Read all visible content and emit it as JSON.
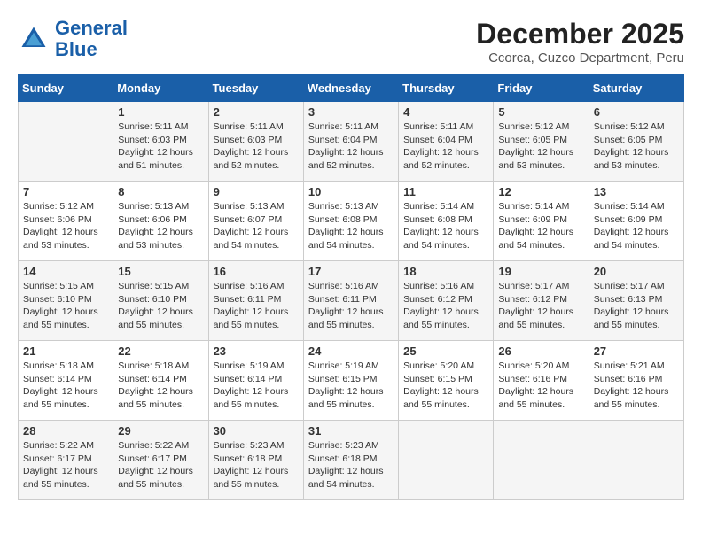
{
  "header": {
    "logo_line1": "General",
    "logo_line2": "Blue",
    "month": "December 2025",
    "location": "Ccorca, Cuzco Department, Peru"
  },
  "days_of_week": [
    "Sunday",
    "Monday",
    "Tuesday",
    "Wednesday",
    "Thursday",
    "Friday",
    "Saturday"
  ],
  "weeks": [
    [
      {
        "day": "",
        "content": ""
      },
      {
        "day": "1",
        "content": "Sunrise: 5:11 AM\nSunset: 6:03 PM\nDaylight: 12 hours\nand 51 minutes."
      },
      {
        "day": "2",
        "content": "Sunrise: 5:11 AM\nSunset: 6:03 PM\nDaylight: 12 hours\nand 52 minutes."
      },
      {
        "day": "3",
        "content": "Sunrise: 5:11 AM\nSunset: 6:04 PM\nDaylight: 12 hours\nand 52 minutes."
      },
      {
        "day": "4",
        "content": "Sunrise: 5:11 AM\nSunset: 6:04 PM\nDaylight: 12 hours\nand 52 minutes."
      },
      {
        "day": "5",
        "content": "Sunrise: 5:12 AM\nSunset: 6:05 PM\nDaylight: 12 hours\nand 53 minutes."
      },
      {
        "day": "6",
        "content": "Sunrise: 5:12 AM\nSunset: 6:05 PM\nDaylight: 12 hours\nand 53 minutes."
      }
    ],
    [
      {
        "day": "7",
        "content": "Sunrise: 5:12 AM\nSunset: 6:06 PM\nDaylight: 12 hours\nand 53 minutes."
      },
      {
        "day": "8",
        "content": "Sunrise: 5:13 AM\nSunset: 6:06 PM\nDaylight: 12 hours\nand 53 minutes."
      },
      {
        "day": "9",
        "content": "Sunrise: 5:13 AM\nSunset: 6:07 PM\nDaylight: 12 hours\nand 54 minutes."
      },
      {
        "day": "10",
        "content": "Sunrise: 5:13 AM\nSunset: 6:08 PM\nDaylight: 12 hours\nand 54 minutes."
      },
      {
        "day": "11",
        "content": "Sunrise: 5:14 AM\nSunset: 6:08 PM\nDaylight: 12 hours\nand 54 minutes."
      },
      {
        "day": "12",
        "content": "Sunrise: 5:14 AM\nSunset: 6:09 PM\nDaylight: 12 hours\nand 54 minutes."
      },
      {
        "day": "13",
        "content": "Sunrise: 5:14 AM\nSunset: 6:09 PM\nDaylight: 12 hours\nand 54 minutes."
      }
    ],
    [
      {
        "day": "14",
        "content": "Sunrise: 5:15 AM\nSunset: 6:10 PM\nDaylight: 12 hours\nand 55 minutes."
      },
      {
        "day": "15",
        "content": "Sunrise: 5:15 AM\nSunset: 6:10 PM\nDaylight: 12 hours\nand 55 minutes."
      },
      {
        "day": "16",
        "content": "Sunrise: 5:16 AM\nSunset: 6:11 PM\nDaylight: 12 hours\nand 55 minutes."
      },
      {
        "day": "17",
        "content": "Sunrise: 5:16 AM\nSunset: 6:11 PM\nDaylight: 12 hours\nand 55 minutes."
      },
      {
        "day": "18",
        "content": "Sunrise: 5:16 AM\nSunset: 6:12 PM\nDaylight: 12 hours\nand 55 minutes."
      },
      {
        "day": "19",
        "content": "Sunrise: 5:17 AM\nSunset: 6:12 PM\nDaylight: 12 hours\nand 55 minutes."
      },
      {
        "day": "20",
        "content": "Sunrise: 5:17 AM\nSunset: 6:13 PM\nDaylight: 12 hours\nand 55 minutes."
      }
    ],
    [
      {
        "day": "21",
        "content": "Sunrise: 5:18 AM\nSunset: 6:14 PM\nDaylight: 12 hours\nand 55 minutes."
      },
      {
        "day": "22",
        "content": "Sunrise: 5:18 AM\nSunset: 6:14 PM\nDaylight: 12 hours\nand 55 minutes."
      },
      {
        "day": "23",
        "content": "Sunrise: 5:19 AM\nSunset: 6:14 PM\nDaylight: 12 hours\nand 55 minutes."
      },
      {
        "day": "24",
        "content": "Sunrise: 5:19 AM\nSunset: 6:15 PM\nDaylight: 12 hours\nand 55 minutes."
      },
      {
        "day": "25",
        "content": "Sunrise: 5:20 AM\nSunset: 6:15 PM\nDaylight: 12 hours\nand 55 minutes."
      },
      {
        "day": "26",
        "content": "Sunrise: 5:20 AM\nSunset: 6:16 PM\nDaylight: 12 hours\nand 55 minutes."
      },
      {
        "day": "27",
        "content": "Sunrise: 5:21 AM\nSunset: 6:16 PM\nDaylight: 12 hours\nand 55 minutes."
      }
    ],
    [
      {
        "day": "28",
        "content": "Sunrise: 5:22 AM\nSunset: 6:17 PM\nDaylight: 12 hours\nand 55 minutes."
      },
      {
        "day": "29",
        "content": "Sunrise: 5:22 AM\nSunset: 6:17 PM\nDaylight: 12 hours\nand 55 minutes."
      },
      {
        "day": "30",
        "content": "Sunrise: 5:23 AM\nSunset: 6:18 PM\nDaylight: 12 hours\nand 55 minutes."
      },
      {
        "day": "31",
        "content": "Sunrise: 5:23 AM\nSunset: 6:18 PM\nDaylight: 12 hours\nand 54 minutes."
      },
      {
        "day": "",
        "content": ""
      },
      {
        "day": "",
        "content": ""
      },
      {
        "day": "",
        "content": ""
      }
    ]
  ]
}
